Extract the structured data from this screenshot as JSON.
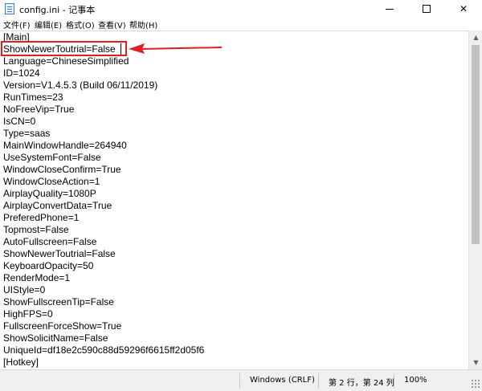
{
  "window": {
    "title": "config.ini - 记事本",
    "minimize_label": "—",
    "close_label": "✕"
  },
  "menu": [
    "文件(F)",
    "编辑(E)",
    "格式(O)",
    "查看(V)",
    "帮助(H)"
  ],
  "editor": {
    "lines": [
      "[Main]",
      "ShowNewerToutrial=False",
      "Language=ChineseSimplified",
      "ID=1024",
      "Version=V1.4.5.3 (Build 06/11/2019)",
      "RunTimes=23",
      "NoFreeVip=True",
      "IsCN=0",
      "Type=saas",
      "MainWindowHandle=264940",
      "UseSystemFont=False",
      "WindowCloseConfirm=True",
      "WindowCloseAction=1",
      "AirplayQuality=1080P",
      "AirplayConvertData=True",
      "PreferedPhone=1",
      "Topmost=False",
      "AutoFullscreen=False",
      "ShowNewerToutrial=False",
      "KeyboardOpacity=50",
      "RenderMode=1",
      "UIStyle=0",
      "ShowFullscreenTip=False",
      "HighFPS=0",
      "FullscreenForceShow=True",
      "ShowSolicitName=False",
      "UniqueId=df18e2c590c88d59296f6615ff2d05f6",
      "[Hotkey]"
    ],
    "highlight_color": "#e02020",
    "arrow_color": "#e02020"
  },
  "status": {
    "line_ending": "Windows (CRLF)",
    "position": "第 2 行，第 24 列",
    "zoom": "100%"
  }
}
